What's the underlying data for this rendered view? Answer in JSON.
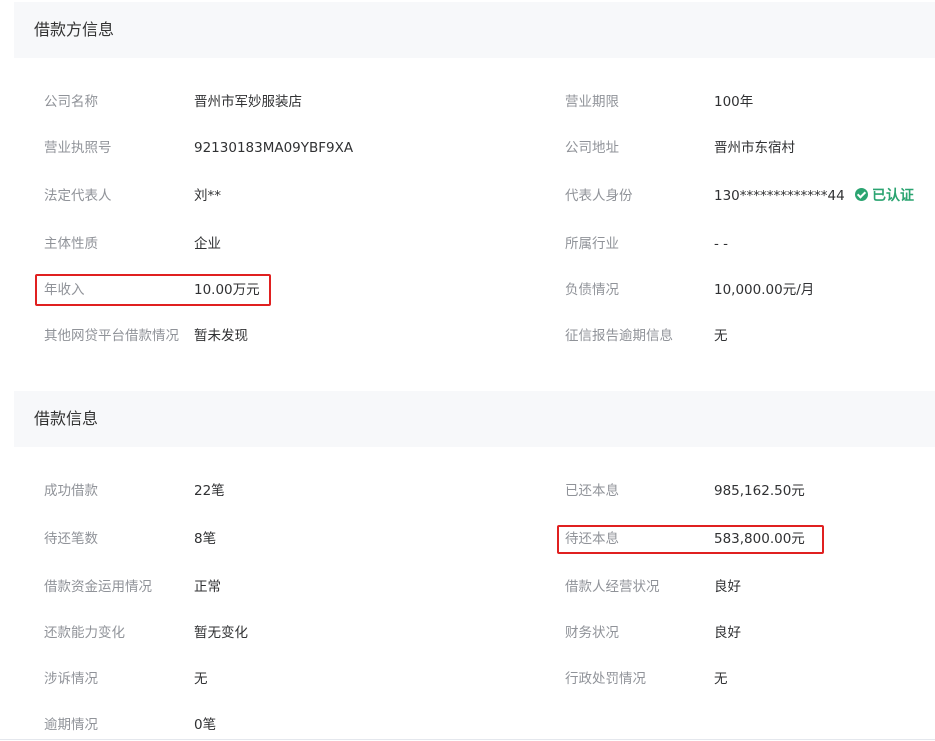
{
  "borrower_section": {
    "title": "借款方信息",
    "rows": [
      {
        "left_label": "公司名称",
        "left_value": "晋州市军妙服装店",
        "right_label": "营业期限",
        "right_value": "100年"
      },
      {
        "left_label": "营业执照号",
        "left_value": "92130183MA09YBF9XA",
        "right_label": "公司地址",
        "right_value": "晋州市东宿村"
      },
      {
        "left_label": "法定代表人",
        "left_value": "刘**",
        "right_label": "代表人身份",
        "right_value": "130*************44",
        "badge": "已认证"
      },
      {
        "left_label": "主体性质",
        "left_value": "企业",
        "right_label": "所属行业",
        "right_value": "- -"
      },
      {
        "left_label": "年收入",
        "left_value": "10.00万元",
        "right_label": "负债情况",
        "right_value": "10,000.00元/月"
      },
      {
        "left_label": "其他网贷平台借款情况",
        "left_value": "暂未发现",
        "right_label": "征信报告逾期信息",
        "right_value": "无"
      }
    ]
  },
  "loan_section": {
    "title": "借款信息",
    "rows": [
      {
        "left_label": "成功借款",
        "left_value": "22笔",
        "right_label": "已还本息",
        "right_value": "985,162.50元"
      },
      {
        "left_label": "待还笔数",
        "left_value": "8笔",
        "right_label": "待还本息",
        "right_value": "583,800.00元"
      },
      {
        "left_label": "借款资金运用情况",
        "left_value": "正常",
        "right_label": "借款人经营状况",
        "right_value": "良好"
      },
      {
        "left_label": "还款能力变化",
        "left_value": "暂无变化",
        "right_label": "财务状况",
        "right_value": "良好"
      },
      {
        "left_label": "涉诉情况",
        "left_value": "无",
        "right_label": "行政处罚情况",
        "right_value": "无"
      },
      {
        "left_label": "逾期情况",
        "left_value": "0笔"
      }
    ]
  },
  "colors": {
    "highlight_border": "#e02020",
    "verified_green": "#2ba471",
    "header_bg": "#f7f8fa"
  },
  "icons": {
    "verified": "check-circle-icon"
  }
}
